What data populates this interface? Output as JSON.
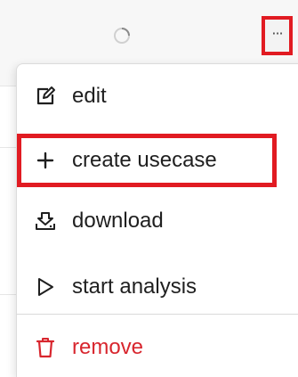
{
  "toolbar": {
    "more_label": "···"
  },
  "menu": {
    "items": [
      {
        "label": "edit",
        "icon": "edit-icon"
      },
      {
        "label": "create usecase",
        "icon": "plus-icon"
      },
      {
        "label": "download",
        "icon": "download-icon"
      },
      {
        "label": "start analysis",
        "icon": "play-icon"
      },
      {
        "label": "remove",
        "icon": "trash-icon"
      }
    ]
  },
  "colors": {
    "highlight": "#e11b22",
    "danger": "#d8262e",
    "text": "#1f1f1f"
  }
}
